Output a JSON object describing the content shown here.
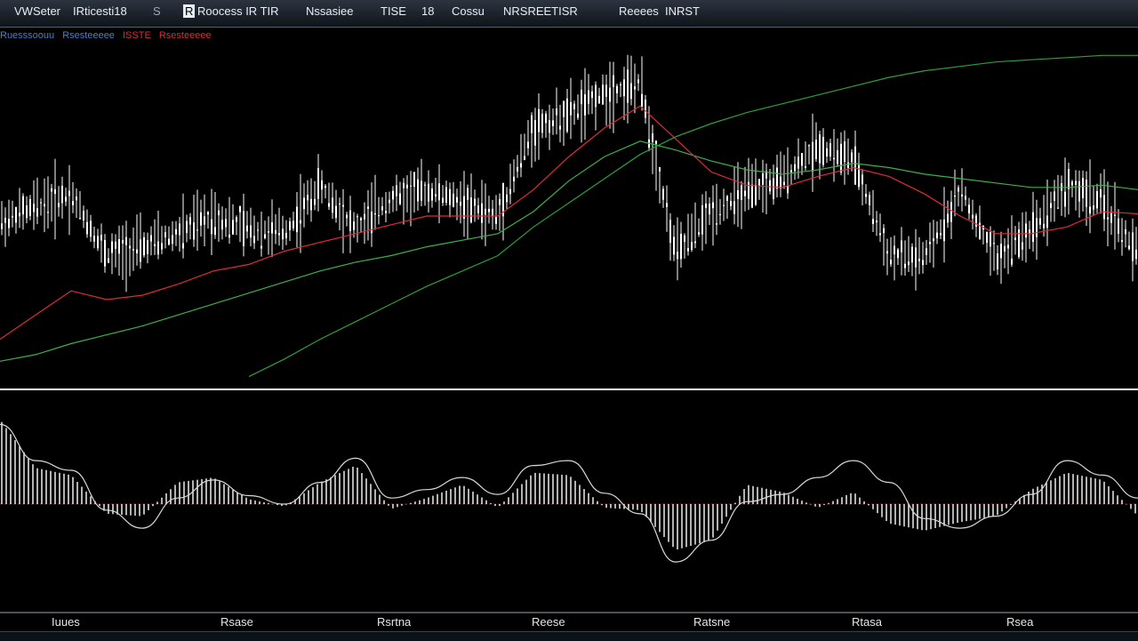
{
  "toolbar": {
    "items": [
      "VWSeter",
      "IRticesti18",
      "S",
      "R",
      "Roocess IR TIR",
      "Nssasiee",
      "TISE",
      "18",
      "Cossu",
      "NRSREETISR",
      "Reeees",
      "INRST"
    ]
  },
  "legend": {
    "items": [
      {
        "text": "Ruesssoouu",
        "color": "#4a7ec8"
      },
      {
        "text": "Rsesteeeee",
        "color": "#4a7ec8"
      },
      {
        "text": "ISSTE",
        "color": "#d0303a"
      },
      {
        "text": "Rsesteeeee",
        "color": "#d0303a"
      },
      {
        "text": "Rsesteeeee",
        "color": "#ffffff"
      }
    ]
  },
  "xaxis": {
    "labels": [
      "Iuues",
      "Rsase",
      "Rsrtna",
      "Reese",
      "Ratsne",
      "Rtasa",
      "Rsea"
    ]
  },
  "colors": {
    "background": "#000000",
    "candles": "#ffffff",
    "ma_fast": "#e02a3a",
    "ma_slow": "#2e9e3a",
    "ma_mid": "#3cb04a",
    "divider": "#ffffff",
    "osc_line": "#d8d8d8"
  },
  "chart_data": [
    {
      "type": "line",
      "panel": "price",
      "xlabel": "",
      "ylabel": "",
      "x": [
        0,
        40,
        80,
        120,
        160,
        200,
        240,
        280,
        320,
        360,
        400,
        440,
        480,
        520,
        560,
        600,
        640,
        680,
        720,
        760,
        800,
        840,
        880,
        920,
        960,
        1000,
        1040,
        1080,
        1120,
        1160,
        1200,
        1240,
        1280
      ],
      "series": [
        {
          "values": [
            75,
            82,
            88,
            60,
            64,
            70,
            78,
            72,
            70,
            92,
            72,
            86,
            90,
            84,
            78,
            118,
            124,
            134,
            138,
            60,
            80,
            88,
            95,
            110,
            103,
            60,
            58,
            90,
            58,
            72,
            92,
            84,
            60
          ]
        },
        {
          "values": [
            22,
            33,
            44,
            40,
            42,
            47,
            53,
            56,
            62,
            66,
            70,
            74,
            78,
            78,
            78,
            90,
            105,
            118,
            128,
            113,
            98,
            92,
            91,
            96,
            100,
            96,
            88,
            78,
            70,
            70,
            73,
            80,
            79
          ]
        },
        {
          "values": [
            12,
            15,
            20,
            24,
            28,
            33,
            38,
            43,
            48,
            53,
            57,
            60,
            64,
            67,
            70,
            80,
            94,
            105,
            112,
            108,
            103,
            99,
            97,
            99,
            102,
            100,
            97,
            95,
            93,
            91,
            91,
            92,
            90
          ]
        },
        {
          "values": [
            null,
            null,
            null,
            null,
            null,
            null,
            null,
            5,
            13,
            22,
            30,
            38,
            46,
            53,
            60,
            73,
            84,
            95,
            106,
            114,
            120,
            125,
            129,
            133,
            137,
            141,
            144,
            146,
            148,
            149,
            150,
            151,
            151
          ]
        }
      ],
      "grid": false
    },
    {
      "type": "bar",
      "panel": "oscillator",
      "x": [
        0,
        40,
        80,
        120,
        160,
        200,
        240,
        280,
        320,
        360,
        400,
        440,
        480,
        520,
        560,
        600,
        640,
        680,
        720,
        760,
        800,
        840,
        880,
        920,
        960,
        1000,
        1040,
        1080,
        1120,
        1160,
        1200,
        1240,
        1280
      ],
      "values": [
        70,
        30,
        24,
        -8,
        -10,
        18,
        22,
        4,
        -2,
        18,
        32,
        -4,
        5,
        16,
        -3,
        26,
        24,
        -3,
        -5,
        -38,
        -30,
        16,
        10,
        -3,
        10,
        -16,
        -22,
        -15,
        -10,
        12,
        26,
        20,
        -10
      ],
      "series": [
        {
          "values": [
            66,
            36,
            28,
            -5,
            -20,
            5,
            20,
            7,
            0,
            18,
            38,
            5,
            12,
            22,
            8,
            32,
            36,
            9,
            -8,
            -48,
            -30,
            2,
            8,
            22,
            36,
            18,
            -12,
            -20,
            -10,
            8,
            36,
            24,
            5
          ]
        }
      ],
      "grid": false
    }
  ]
}
